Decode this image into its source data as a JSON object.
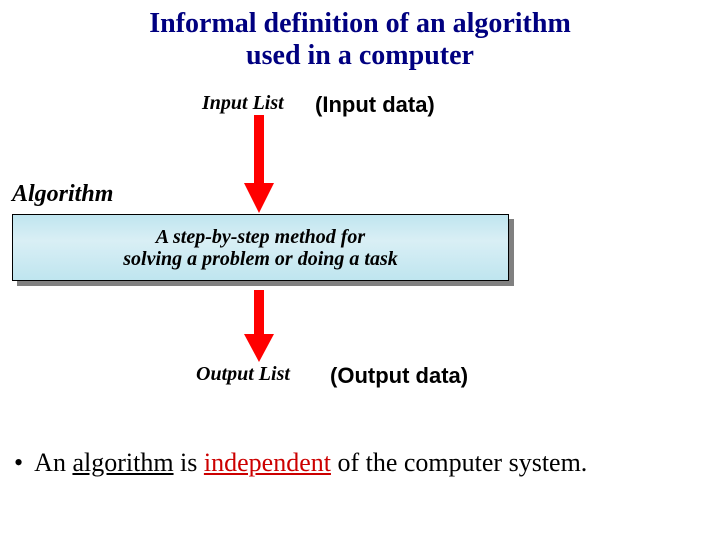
{
  "title_line1": "Informal definition of an algorithm",
  "title_line2": "used in a computer",
  "labels": {
    "input_list": "Input List",
    "output_list": "Output List",
    "algorithm": "Algorithm"
  },
  "annotations": {
    "input_data": "(Input data)",
    "output_data": "(Output data)"
  },
  "algo_box": "A step-by-step method for\nsolving a problem or doing a task",
  "bullet": {
    "bullet_char": "•",
    "pre": " An ",
    "algorithm_word": "algorithm",
    "mid": " is ",
    "indep_word": "independent",
    "post": " of the computer system."
  }
}
